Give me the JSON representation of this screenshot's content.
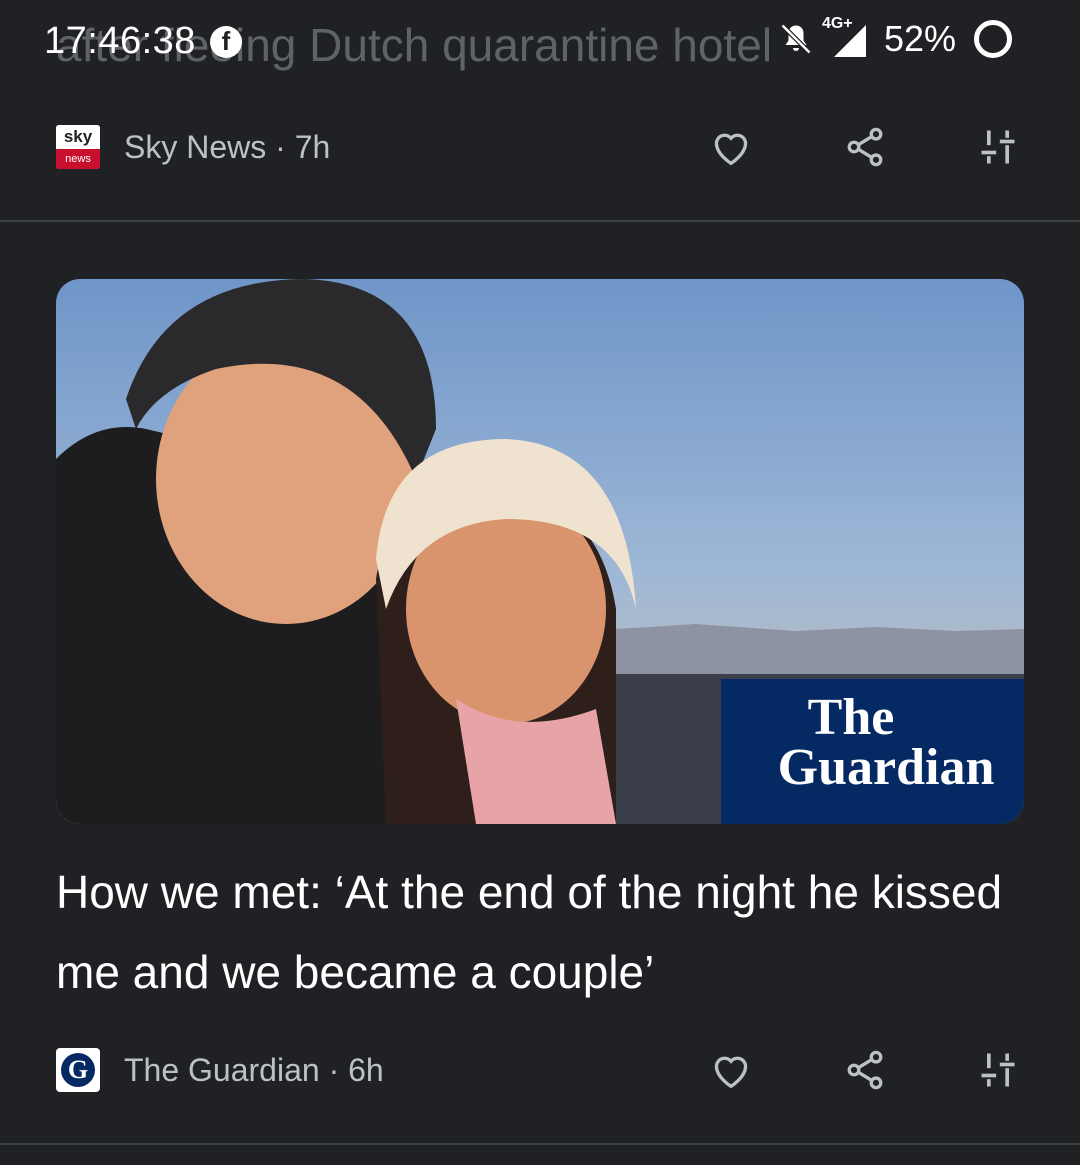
{
  "status_bar": {
    "time": "17:46:38",
    "network": "4G+",
    "battery": "52%"
  },
  "previous_card": {
    "headline_fragment": "after fleeing Dutch quarantine hotel",
    "source_label": "Sky News · 7h",
    "logo_line1": "sky",
    "logo_line2": "news"
  },
  "card": {
    "image_watermark_line1": "The",
    "image_watermark_line2": "Guardian",
    "headline": "How we met: ‘At the end of the night he kissed me and we became a couple’",
    "source_label": "The Guardian · 6h",
    "logo_letter": "G"
  },
  "icons": {
    "like": "heart-outline-icon",
    "share": "share-icon",
    "more": "tune-icon"
  },
  "colors": {
    "background": "#202124",
    "guardian_blue": "#052962",
    "sky_red": "#c8102e"
  }
}
